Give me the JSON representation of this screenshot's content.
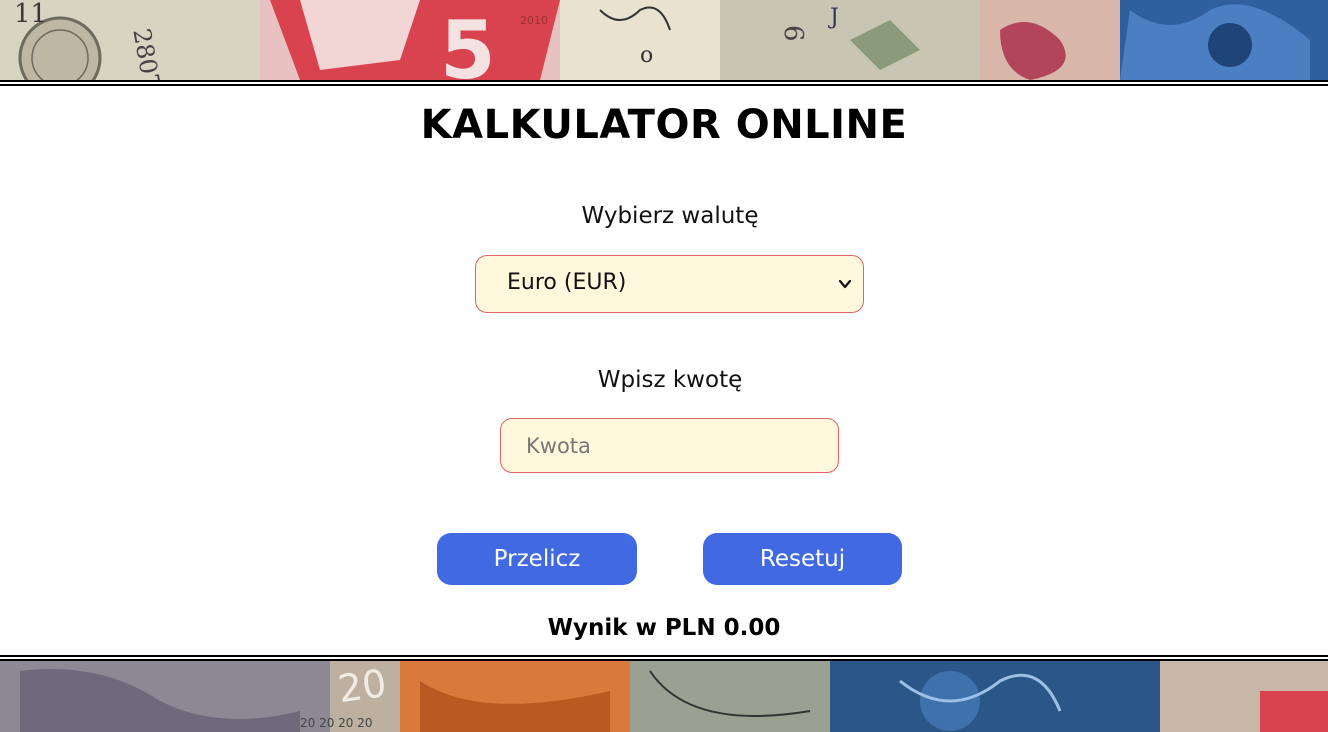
{
  "header": {
    "title": "KALKULATOR ONLINE"
  },
  "form": {
    "currency_label": "Wybierz walutę",
    "currency_selected": "Euro (EUR)",
    "amount_label": "Wpisz kwotę",
    "amount_placeholder": "Kwota",
    "amount_value": ""
  },
  "buttons": {
    "convert_label": "Przelicz",
    "reset_label": "Resetuj"
  },
  "result": {
    "text": "Wynik w PLN 0.00"
  },
  "colors": {
    "button": "#4169e1",
    "input_bg": "#fff8dc",
    "input_border": "#e06464"
  },
  "icons": {
    "select_arrow": "chevron-down-icon",
    "banner": "banknotes-image"
  }
}
